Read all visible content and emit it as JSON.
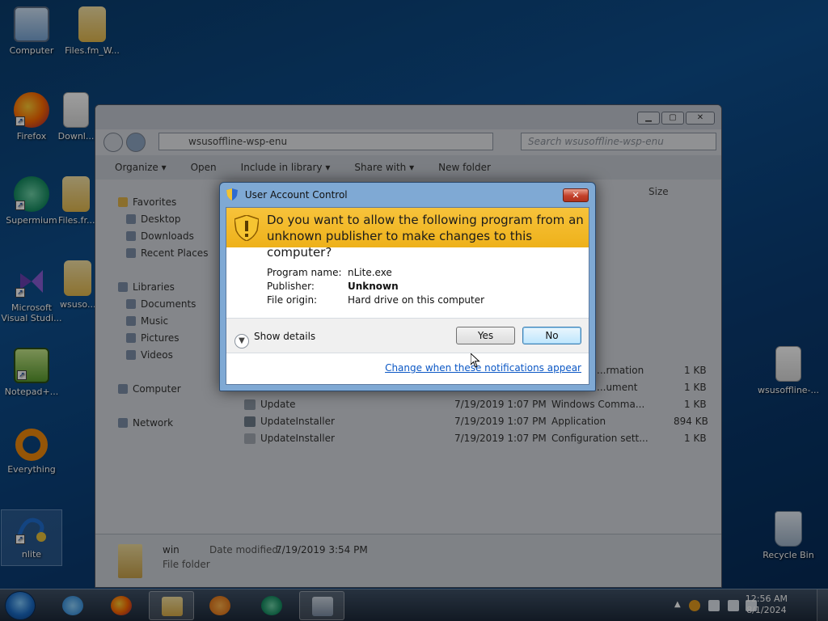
{
  "desktop": {
    "icons": [
      {
        "label": "Computer",
        "icon": "computer-icon"
      },
      {
        "label": "Files.fm_W...",
        "icon": "folder-icon"
      },
      {
        "label": "Firefox",
        "icon": "firefox-icon"
      },
      {
        "label": "Downl...",
        "icon": "document-icon"
      },
      {
        "label": "Supermium",
        "icon": "supermium-icon"
      },
      {
        "label": "Files.fr...",
        "icon": "folder-icon"
      },
      {
        "label": "Microsoft Visual Studi...",
        "icon": "visual-studio-icon"
      },
      {
        "label": "wsuso...",
        "icon": "folder-icon"
      },
      {
        "label": "Notepad+...",
        "icon": "notepad-plus-plus-icon"
      },
      {
        "label": "Everything",
        "icon": "everything-icon"
      },
      {
        "label": "nlite",
        "icon": "nlite-icon"
      },
      {
        "label": "wsusoffline-...",
        "icon": "document-icon"
      },
      {
        "label": "Recycle Bin",
        "icon": "recycle-bin-icon"
      }
    ]
  },
  "explorer": {
    "address_path": "wsusoffline-wsp-enu",
    "search_placeholder": "Search wsusoffline-wsp-enu",
    "toolbar": {
      "organize": "Organize ▾",
      "open": "Open",
      "include_in_library": "Include in library ▾",
      "share_with": "Share with ▾",
      "new_folder": "New folder"
    },
    "column_size": "Size",
    "nav": {
      "favorites": "Favorites",
      "desktop": "Desktop",
      "downloads": "Downloads",
      "recent_places": "Recent Places",
      "libraries": "Libraries",
      "documents": "Documents",
      "music": "Music",
      "pictures": "Pictures",
      "videos": "Videos",
      "computer": "Computer",
      "network": "Network"
    },
    "partial_rows": [
      {
        "type": "...rmation",
        "size": "1 KB"
      },
      {
        "type": "...ument",
        "size": "1 KB"
      }
    ],
    "files": [
      {
        "name": "Update",
        "date": "7/19/2019 1:07 PM",
        "type": "Windows Comma...",
        "size": "1 KB"
      },
      {
        "name": "UpdateInstaller",
        "date": "7/19/2019 1:07 PM",
        "type": "Application",
        "size": "894 KB"
      },
      {
        "name": "UpdateInstaller",
        "date": "7/19/2019 1:07 PM",
        "type": "Configuration sett...",
        "size": "1 KB"
      }
    ],
    "details": {
      "name": "win",
      "modified_label": "Date modified:",
      "modified_value": "7/19/2019 3:54 PM",
      "kind": "File folder"
    }
  },
  "uac": {
    "title": "User Account Control",
    "close_glyph": "✕",
    "question": "Do you want to allow the following program from an unknown publisher to make changes to this computer?",
    "program_name_label": "Program name:",
    "program_name_value": "nLite.exe",
    "publisher_label": "Publisher:",
    "publisher_value": "Unknown",
    "file_origin_label": "File origin:",
    "file_origin_value": "Hard drive on this computer",
    "show_details": "Show details",
    "yes": "Yes",
    "no": "No",
    "link": "Change when these notifications appear",
    "banner_color": "#f4bb2a"
  },
  "taskbar": {
    "clock_time": "12:56 AM",
    "clock_date": "8/1/2024",
    "pinned": [
      "internet-explorer-icon",
      "firefox-icon",
      "windows-explorer-icon",
      "media-player-icon",
      "supermium-icon",
      "uac-task-icon"
    ]
  }
}
